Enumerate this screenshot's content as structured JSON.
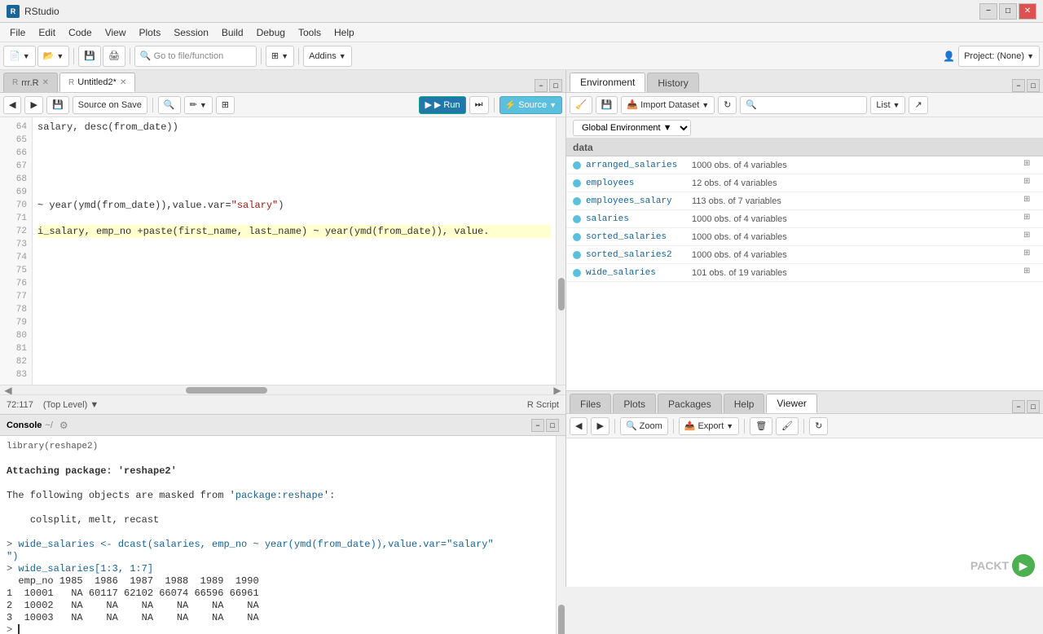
{
  "titleBar": {
    "appName": "RStudio",
    "icon": "R"
  },
  "menuBar": {
    "items": [
      "File",
      "Edit",
      "Code",
      "View",
      "Plots",
      "Session",
      "Build",
      "Debug",
      "Tools",
      "Help"
    ]
  },
  "toolbar": {
    "newFileBtn": "📄",
    "openBtn": "📂",
    "saveBtn": "💾",
    "printBtn": "🖨",
    "goToFileBtn": "Go to file/function",
    "optionsBtn": "⚙",
    "addinsBtn": "Addins",
    "projectLabel": "Project: (None)"
  },
  "editorTabs": [
    {
      "id": "rrr",
      "label": "rrr.R",
      "active": false
    },
    {
      "id": "untitled2",
      "label": "Untitled2*",
      "active": true
    }
  ],
  "editorToolbar": {
    "saveBtn": "💾",
    "sourceOnSaveLabel": "Source on Save",
    "searchBtn": "🔍",
    "formatBtn": "✏",
    "runBtn": "▶ Run",
    "continueBtn": "⏭",
    "sourceLabel": "Source"
  },
  "codeLines": [
    {
      "num": 64,
      "text": "salary, desc(from_date))"
    },
    {
      "num": 65,
      "text": ""
    },
    {
      "num": 66,
      "text": ""
    },
    {
      "num": 67,
      "text": ""
    },
    {
      "num": 68,
      "text": ""
    },
    {
      "num": 69,
      "text": ""
    },
    {
      "num": 70,
      "text": "~ year(ymd(from_date)),value.var=\"salary\")"
    },
    {
      "num": 71,
      "text": ""
    },
    {
      "num": 72,
      "text": "i_salary, emp_no +paste(first_name, last_name) ~ year(ymd(from_date)), value.",
      "highlight": true
    },
    {
      "num": 73,
      "text": ""
    },
    {
      "num": 74,
      "text": ""
    },
    {
      "num": 75,
      "text": ""
    },
    {
      "num": 76,
      "text": ""
    },
    {
      "num": 77,
      "text": ""
    },
    {
      "num": 78,
      "text": ""
    },
    {
      "num": 79,
      "text": ""
    },
    {
      "num": 80,
      "text": ""
    },
    {
      "num": 81,
      "text": ""
    },
    {
      "num": 82,
      "text": ""
    },
    {
      "num": 83,
      "text": ""
    }
  ],
  "editorStatus": {
    "position": "72:117",
    "scope": "(Top Level)",
    "fileType": "R Script"
  },
  "consoleTabs": [
    {
      "label": "Console",
      "path": "~/",
      "active": true
    }
  ],
  "consoleLines": [
    {
      "type": "output",
      "text": "library(reshape2)"
    },
    {
      "type": "output",
      "text": ""
    },
    {
      "type": "info",
      "text": "Attaching package: 'reshape2'"
    },
    {
      "type": "output",
      "text": ""
    },
    {
      "type": "info",
      "text": "The following objects are masked from 'package:reshape':"
    },
    {
      "type": "output",
      "text": ""
    },
    {
      "type": "indent",
      "text": "    colsplit, melt, recast"
    },
    {
      "type": "output",
      "text": ""
    },
    {
      "type": "prompt",
      "code": "wide_salaries <- dcast(salaries, emp_no ~ year(ymd(from_date)),value.var=\"salary\")"
    },
    {
      "type": "prompt",
      "code": "wide_salaries[1:3, 1:7]"
    },
    {
      "type": "output",
      "text": "  emp_no 1985  1986  1987  1988  1989  1990"
    },
    {
      "type": "output",
      "text": "1  10001   NA 60117 62102 66074 66596 66961"
    },
    {
      "type": "output",
      "text": "2  10002   NA    NA    NA    NA    NA    NA"
    },
    {
      "type": "output",
      "text": "3  10003   NA    NA    NA    NA    NA    NA"
    },
    {
      "type": "prompt-empty",
      "text": ">"
    }
  ],
  "envTabs": [
    {
      "label": "Environment",
      "active": true
    },
    {
      "label": "History",
      "active": false
    }
  ],
  "envToolbar": {
    "importDatasetBtn": "Import Dataset",
    "listViewBtn": "List",
    "globalEnvLabel": "Global Environment"
  },
  "envSectionHeader": "data",
  "envItems": [
    {
      "name": "arranged_salaries",
      "desc": "1000 obs. of 4 variables"
    },
    {
      "name": "employees",
      "desc": "12 obs. of 4 variables"
    },
    {
      "name": "employees_salary",
      "desc": "113 obs. of 7 variables"
    },
    {
      "name": "salaries",
      "desc": "1000 obs. of 4 variables"
    },
    {
      "name": "sorted_salaries",
      "desc": "1000 obs. of 4 variables"
    },
    {
      "name": "sorted_salaries2",
      "desc": "1000 obs. of 4 variables"
    },
    {
      "name": "wide_salaries",
      "desc": "101 obs. of 19 variables"
    }
  ],
  "filesTabs": [
    {
      "label": "Files",
      "active": false
    },
    {
      "label": "Plots",
      "active": false
    },
    {
      "label": "Packages",
      "active": false
    },
    {
      "label": "Help",
      "active": false
    },
    {
      "label": "Viewer",
      "active": true
    }
  ],
  "filesToolbar": {
    "backBtn": "◀",
    "forwardBtn": "▶",
    "zoomBtn": "Zoom",
    "exportBtn": "Export",
    "refreshBtn": "↻",
    "clearBtn": "🗑",
    "brushBtn": "🖌"
  },
  "packt": {
    "text": "PACKT"
  }
}
